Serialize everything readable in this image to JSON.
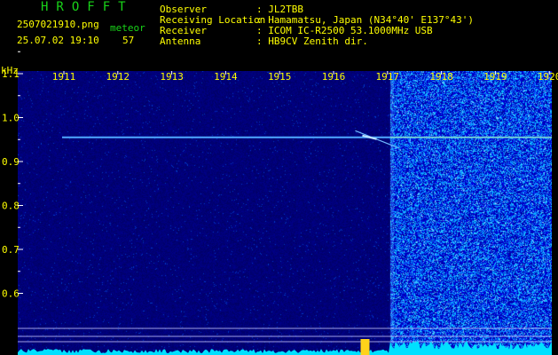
{
  "header": {
    "brand": "HROFFT",
    "filename": "2507021910.png",
    "datetime": "25.07.02 19:10",
    "mode_label": "meteor",
    "count": "57"
  },
  "station_info": [
    {
      "label": "Observer",
      "value": ": JL2TBB"
    },
    {
      "label": "Receiving Location",
      "value": ": Hamamatsu, Japan (N34°40' E137°43')"
    },
    {
      "label": "Receiver",
      "value": ": ICOM IC-R2500 53.1000MHz USB"
    },
    {
      "label": "Antenna",
      "value": ": HB9CV Zenith dir."
    }
  ],
  "chart_data": {
    "type": "spectrogram",
    "y_unit": "kHz",
    "x_ticks": [
      "1911",
      "1912",
      "1913",
      "1914",
      "1915",
      "1916",
      "1917",
      "1918",
      "1919",
      "1920"
    ],
    "y_ticks": [
      1.1,
      1.0,
      0.9,
      0.8,
      0.7,
      0.6
    ],
    "ylim": [
      0.58,
      1.16
    ],
    "carrier_khz": 0.955,
    "meteor_echo": {
      "time": "1916.6",
      "freq_khz": [
        0.97,
        0.93
      ]
    },
    "noise_burst_from": "1917.05",
    "colors": {
      "background": "#00007a",
      "carrier": "#4fa8ff",
      "burst": "#1a4bd6",
      "tick_labels": "#ffff00",
      "header_text": "#ffff00",
      "brand": "#19d419",
      "baseline": "#00e0ff"
    }
  }
}
